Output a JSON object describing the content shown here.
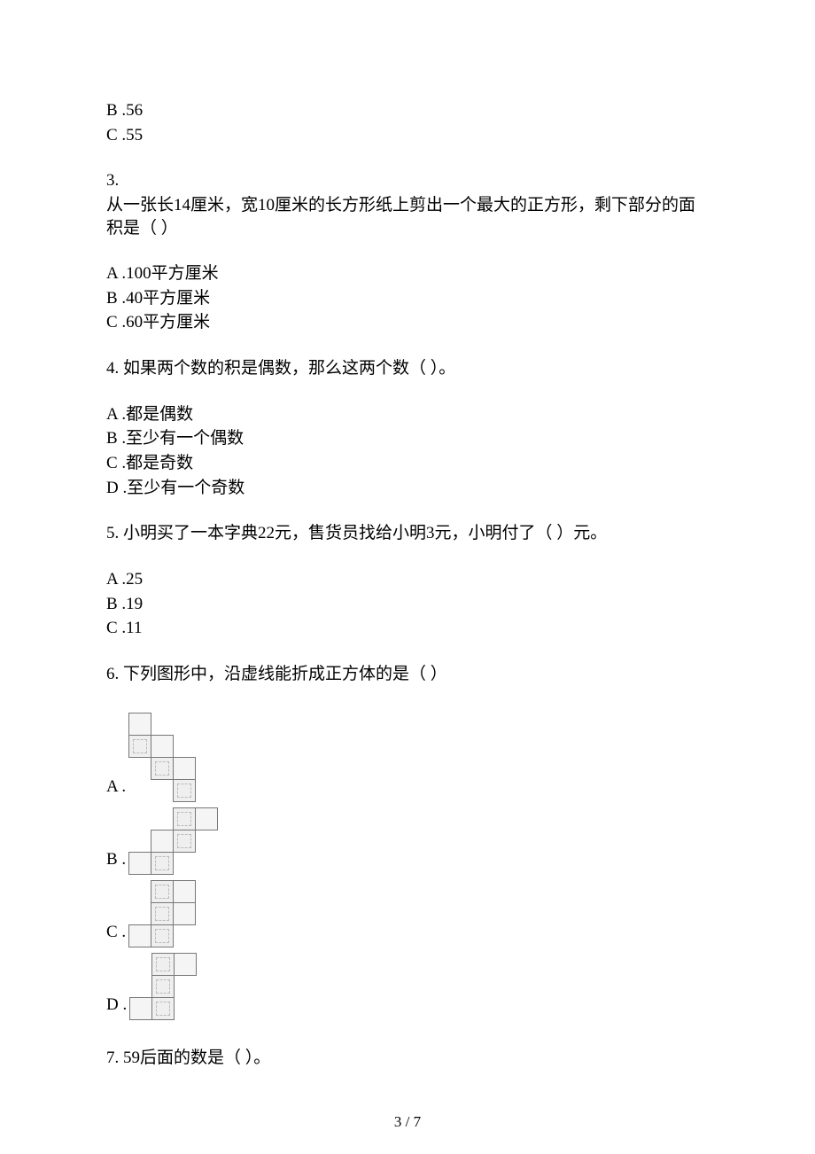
{
  "q2_tail": {
    "b": "B .56",
    "c": "C .55"
  },
  "q3": {
    "num": "3.",
    "text": "从一张长14厘米，宽10厘米的长方形纸上剪出一个最大的正方形，剩下部分的面积是（ ）",
    "a": "A .100平方厘米",
    "b": "B .40平方厘米",
    "c": "C .60平方厘米"
  },
  "q4": {
    "text": "4. 如果两个数的积是偶数，那么这两个数（ ）。",
    "a": "A .都是偶数",
    "b": "B .至少有一个偶数",
    "c": "C .都是奇数",
    "d": "D .至少有一个奇数"
  },
  "q5": {
    "text": "5. 小明买了一本字典22元，售货员找给小明3元，小明付了（ ）元。",
    "a": "A .25",
    "b": "B .19",
    "c": "C .11"
  },
  "q6": {
    "text": "6. 下列图形中，沿虚线能折成正方体的是（ ）",
    "a": "A .",
    "b": "B .",
    "c": "C .",
    "d": "D ."
  },
  "q7": {
    "text": "7. 59后面的数是（ ）。"
  },
  "footer": "3 / 7"
}
